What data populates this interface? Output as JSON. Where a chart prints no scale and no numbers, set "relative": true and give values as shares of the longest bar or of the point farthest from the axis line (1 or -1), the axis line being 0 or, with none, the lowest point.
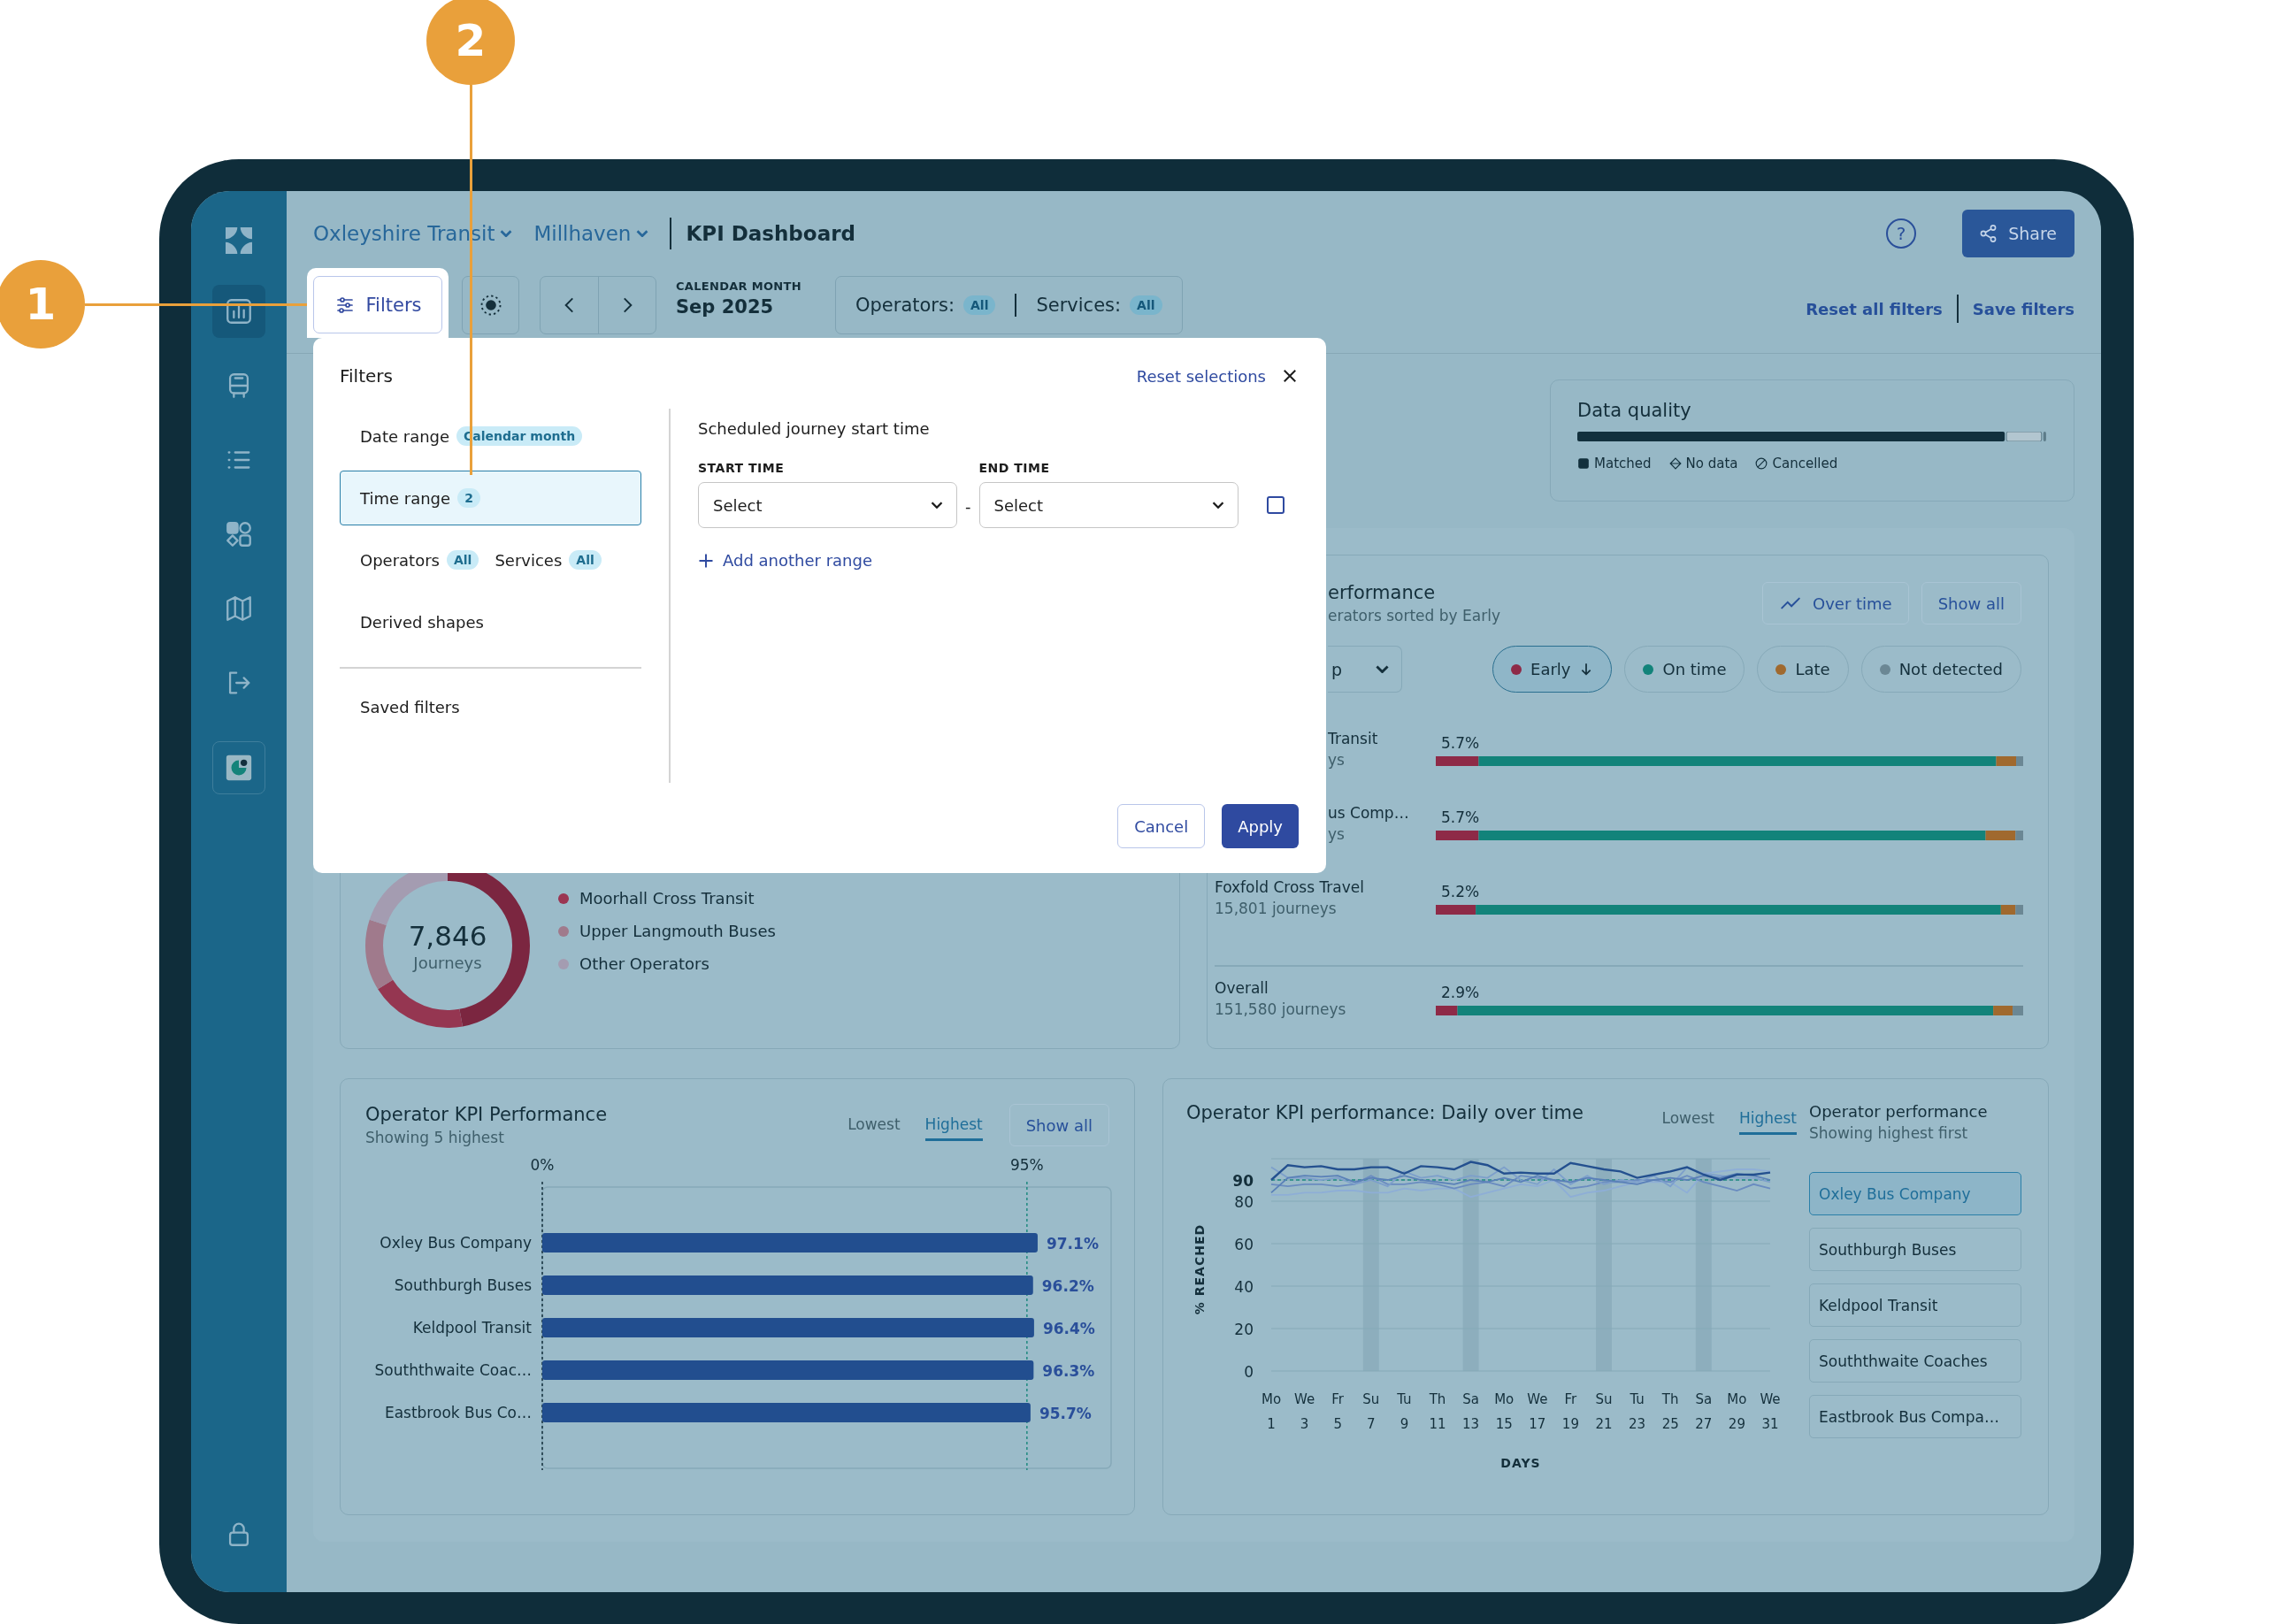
{
  "callouts": [
    {
      "label": "1"
    },
    {
      "label": "2"
    }
  ],
  "sidebar": {
    "items": [
      {
        "kind": "chart",
        "selected": true
      },
      {
        "kind": "bus",
        "selected": false
      },
      {
        "kind": "list",
        "selected": false
      },
      {
        "kind": "shapes",
        "selected": false
      },
      {
        "kind": "map",
        "selected": false
      },
      {
        "kind": "exit",
        "selected": false
      },
      {
        "kind": "app",
        "selected": false
      },
      {
        "kind": "lock",
        "selected": false
      }
    ]
  },
  "header": {
    "breadcrumbs": [
      {
        "label": "Oxleyshire Transit"
      },
      {
        "label": "Millhaven"
      }
    ],
    "page_title": "KPI Dashboard",
    "help": "?",
    "share": "Share"
  },
  "toolbar": {
    "filters": "Filters",
    "period_label": "CALENDAR MONTH",
    "period_value": "Sep 2025",
    "scopes": [
      {
        "label": "Operators:",
        "badge": "All"
      },
      {
        "label": "Services:",
        "badge": "All"
      }
    ],
    "links": [
      "Reset all filters",
      "Save filters"
    ]
  },
  "filter_panel": {
    "title": "Filters",
    "reset": "Reset selections",
    "sections": [
      {
        "parts": [
          {
            "label": "Date range",
            "badge": "Calendar month"
          }
        ],
        "selected": false
      },
      {
        "parts": [
          {
            "label": "Time range",
            "badge": "2"
          }
        ],
        "selected": true
      },
      {
        "parts": [
          {
            "label": "Operators",
            "badge": "All"
          },
          {
            "label": "Services",
            "badge": "All"
          }
        ],
        "selected": false
      },
      {
        "parts": [
          {
            "label": "Derived shapes"
          }
        ],
        "selected": false
      }
    ],
    "saved": "Saved filters",
    "heading": "Scheduled journey start time",
    "fields": [
      {
        "label": "START TIME",
        "placeholder": "Select"
      },
      {
        "label": "END TIME",
        "placeholder": "Select"
      }
    ],
    "separator": "-",
    "checkbox": {
      "checked": false
    },
    "add": "Add another range",
    "buttons": [
      {
        "label": "Cancel",
        "kind": "secondary"
      },
      {
        "label": "Apply",
        "kind": "primary"
      }
    ]
  },
  "data_quality": {
    "title": "Data quality",
    "legend": [
      {
        "kind": "matched",
        "label": "Matched"
      },
      {
        "kind": "no_data",
        "label": "No data"
      },
      {
        "kind": "cancelled",
        "label": "Cancelled"
      }
    ]
  },
  "punctuality": {
    "title": "erformance",
    "subtitle": "erators sorted by Early",
    "dropdown": "p",
    "buttons": [
      {
        "label": "Over time",
        "kind": "trend"
      },
      {
        "label": "Show all",
        "kind": "plain"
      }
    ],
    "chips": [
      {
        "label": "Early",
        "color": "#8e2a47",
        "selected": true
      },
      {
        "label": "On time",
        "color": "#12837a",
        "selected": false
      },
      {
        "label": "Late",
        "color": "#a0692e",
        "selected": false
      },
      {
        "label": "Not detected",
        "color": "#6b8794",
        "selected": false
      }
    ],
    "rows": [
      {
        "kind": "operator",
        "name": "Transit",
        "sub": "ys",
        "reading": "5.7%",
        "cut": true
      },
      {
        "kind": "operator",
        "name": "us Comp…",
        "sub": "ys",
        "reading": "5.7%",
        "cut": true
      },
      {
        "kind": "operator",
        "name": "Foxfold Cross Travel",
        "sub": "15,801 journeys",
        "reading": "5.2%",
        "cut": false
      },
      {
        "kind": "total",
        "name": "Overall",
        "sub": "151,580 journeys",
        "reading": "2.9%",
        "cut": false
      }
    ],
    "chart_data": {
      "type": "bar",
      "orientation": "horizontal",
      "stacked": true,
      "relative": true,
      "series": [
        {
          "color": "#8e2a47",
          "values": [
            0.073,
            0.073,
            0.068,
            0.037
          ]
        },
        {
          "color": "#12837a",
          "values": [
            0.881,
            0.863,
            0.894,
            0.912
          ]
        },
        {
          "color": "#a0692e",
          "values": [
            0.034,
            0.051,
            0.025,
            0.033
          ]
        },
        {
          "color": "#6b8794",
          "values": [
            0.012,
            0.013,
            0.013,
            0.018
          ]
        }
      ]
    }
  },
  "donut": {
    "total": "7,846",
    "unit": "Journeys",
    "legend": [
      {
        "label": "Moorhall Cross Transit",
        "color": "#9b3552"
      },
      {
        "label": "Upper Langmouth Buses",
        "color": "#a07a8c"
      },
      {
        "label": "Other Operators",
        "color": "#a49cb1"
      }
    ]
  },
  "kpi_ranking": {
    "title": "Operator KPI Performance",
    "subtitle": "Showing 5 highest",
    "tabs": [
      {
        "label": "Lowest",
        "selected": false
      },
      {
        "label": "Highest",
        "selected": true
      }
    ],
    "show_all": "Show all",
    "chart_data": {
      "type": "bar",
      "orientation": "horizontal",
      "categories": [
        "Oxley Bus Company",
        "Southburgh Buses",
        "Keldpool Transit",
        "Souththwaite Coac…",
        "Eastbrook Bus Co…"
      ],
      "values": [
        97.1,
        96.2,
        96.4,
        96.3,
        95.7
      ],
      "xticks": [
        {
          "value": 0,
          "label": "0%"
        },
        {
          "value": 95,
          "label": "95%"
        }
      ],
      "xlim": [
        0,
        111.5
      ],
      "ref_lines": [
        {
          "axis": "x",
          "value": 95
        }
      ],
      "value_labels": [
        "97.1%",
        "96.2%",
        "96.4%",
        "96.3%",
        "95.7%"
      ]
    }
  },
  "kpi_daily": {
    "title": "Operator KPI performance: Daily over time",
    "tabs": [
      {
        "label": "Lowest",
        "selected": false
      },
      {
        "label": "Highest",
        "selected": true
      }
    ],
    "side_title": "Operator performance",
    "side_subtitle": "Showing highest first",
    "operators": [
      {
        "label": "Oxley Bus Company",
        "selected": true
      },
      {
        "label": "Southburgh Buses",
        "selected": false
      },
      {
        "label": "Keldpool Transit",
        "selected": false
      },
      {
        "label": "Souththwaite Coaches",
        "selected": false
      },
      {
        "label": "Eastbrook Bus Compa…",
        "selected": false
      }
    ],
    "chart_data": {
      "type": "line",
      "xlabel": "DAYS",
      "ylabel": "% REACHED",
      "grid": true,
      "categories": [
        "Mo 1",
        null,
        "We 3",
        null,
        "Fr 5",
        null,
        "Su 7",
        null,
        "Tu 9",
        null,
        "Th 11",
        null,
        "Sa 13",
        null,
        "Mo 15",
        null,
        "We 17",
        null,
        "Fr 19",
        null,
        "Su 21",
        null,
        "Tu 23",
        null,
        "Th 25",
        null,
        "Sa 27",
        null,
        "Mo 29",
        null,
        "We 31"
      ],
      "yticks": [
        0,
        20,
        40,
        60,
        80,
        90
      ],
      "ylim": [
        0,
        100
      ],
      "series": [
        {
          "color": "#24508f",
          "values": [
            90,
            97,
            96,
            96.5,
            95,
            95,
            96,
            96,
            93,
            96.5,
            96,
            95,
            98.5,
            97,
            93,
            93.5,
            93,
            93,
            98,
            96.5,
            95,
            94,
            91,
            92.5,
            94,
            96,
            92.5,
            90,
            92.5,
            92.5,
            93.5
          ]
        },
        {
          "color": "#5a80b8",
          "values": [
            84,
            91,
            92,
            91.5,
            92,
            89,
            91,
            90,
            92,
            90,
            89,
            88,
            90,
            89,
            91,
            89,
            92,
            90,
            89,
            91,
            90,
            89,
            88,
            90,
            91,
            90,
            92,
            91,
            93,
            92,
            90
          ]
        },
        {
          "color": "#7d9fcb",
          "values": [
            96,
            91,
            91,
            90,
            91,
            88,
            90,
            87,
            94,
            91,
            92,
            90,
            92,
            91,
            96,
            90,
            88,
            95,
            88,
            92,
            88,
            90,
            89,
            92,
            87,
            96,
            93,
            92,
            91,
            91,
            89
          ]
        },
        {
          "color": "#6a8cc0",
          "values": [
            88,
            87,
            88,
            88,
            87,
            88,
            92,
            88,
            88,
            89,
            88,
            86,
            88,
            89,
            87,
            92,
            91,
            90,
            86,
            87,
            89,
            89,
            90,
            90,
            89,
            92,
            89,
            87,
            85,
            88,
            86
          ]
        },
        {
          "color": "#8eaed6",
          "values": [
            83,
            83,
            84,
            84,
            85,
            85,
            84,
            84,
            86,
            85,
            86,
            86,
            82,
            84,
            86,
            88,
            87,
            90,
            82,
            84,
            85,
            87,
            89,
            89,
            89,
            84,
            93,
            94,
            95,
            95,
            94
          ]
        }
      ],
      "ref_lines": [
        {
          "axis": "y",
          "value": 90
        }
      ],
      "bands": [
        {
          "axis": "x",
          "from": "Su 7",
          "to": "Su 7"
        },
        {
          "axis": "x",
          "from": "Sa 13",
          "to": "Sa 13"
        },
        {
          "axis": "x",
          "from": "Su 21",
          "to": "Su 21"
        },
        {
          "axis": "x",
          "from": "Sa 27",
          "to": "Sa 27"
        }
      ]
    }
  }
}
